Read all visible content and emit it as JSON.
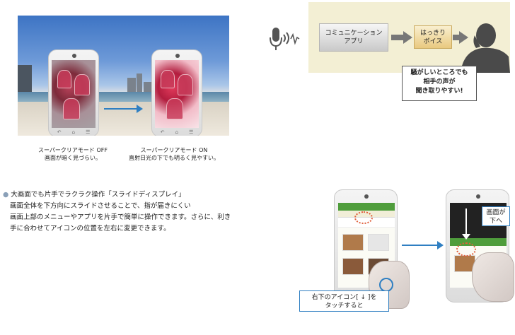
{
  "clear_mode": {
    "off_caption": [
      "スーパークリアモード OFF",
      "画面が暗く見づらい。"
    ],
    "on_caption": [
      "スーパークリアモード ON",
      "直射日光の下でも明るく見やすい。"
    ]
  },
  "voice": {
    "comm_app_label": [
      "コミュニケーション",
      "アプリ"
    ],
    "clear_voice_label": [
      "はっきり",
      "ボイス"
    ],
    "callout": [
      "騒がしいところでも",
      "相手の声が",
      "聞き取りやすい!"
    ]
  },
  "slide_display": {
    "lines": [
      "大画面でも片手でラクラク操作「スライドディスプレイ」",
      "画面全体を下方向にスライドさせることで、指が届きにくい",
      "画面上部のメニューやアプリを片手で簡単に操作できます。さらに、利き",
      "手に合わせてアイコンの位置を左右に変更できます。"
    ],
    "touch_label": [
      "右下のアイコン[ ↓ ]を",
      "タッチすると"
    ],
    "slide_label": [
      "画面が",
      "下へ"
    ]
  },
  "colors": {
    "accent_blue": "#2f7fc2",
    "panel_cream": "#f3efd4",
    "highlight_gold": "#e9c980"
  }
}
